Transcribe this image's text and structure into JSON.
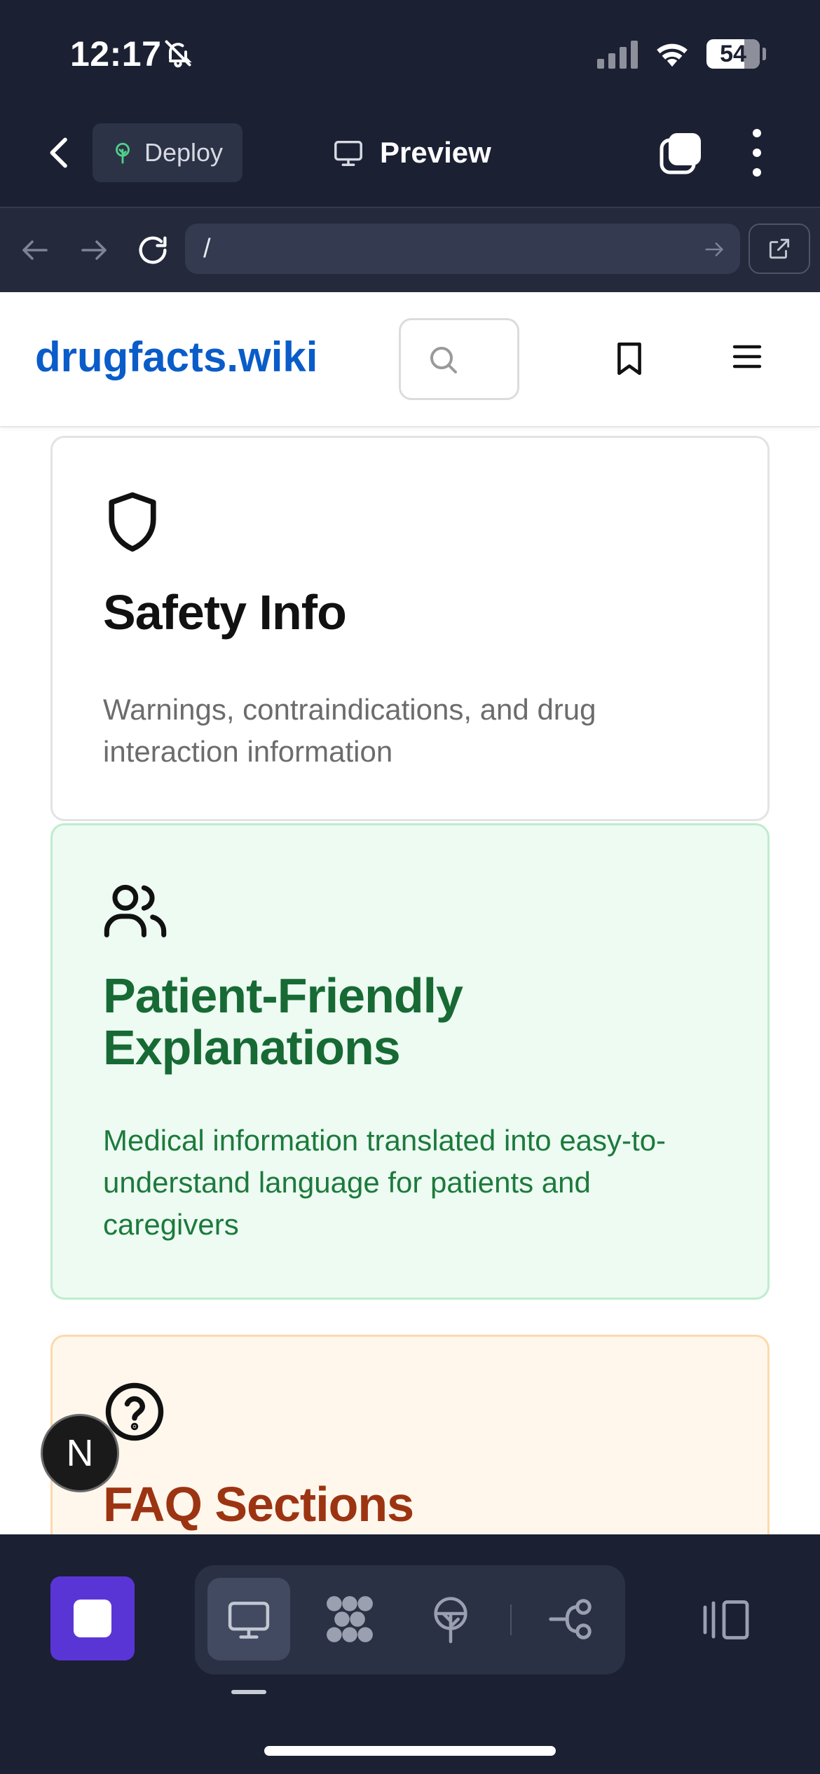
{
  "status": {
    "time": "12:17",
    "battery": "54"
  },
  "topbar": {
    "deploy_label": "Deploy",
    "preview_label": "Preview"
  },
  "urlbar": {
    "url": "/"
  },
  "site": {
    "logo": "drugfacts.wiki"
  },
  "cards": [
    {
      "title": "Safety Info",
      "description": "Warnings, contraindications, and drug interaction information"
    },
    {
      "title": "Patient-Friendly Explanations",
      "description": "Medical information translated into easy-to-understand language for patients and caregivers"
    },
    {
      "title": "FAQ Sections"
    }
  ],
  "fab": {
    "label": "N"
  },
  "colors": {
    "chrome_bg": "#1b2033",
    "logo_blue": "#0a5cc9",
    "green_title": "#176a34",
    "orange_title": "#9c3412",
    "stop_purple": "#5a35d6"
  }
}
